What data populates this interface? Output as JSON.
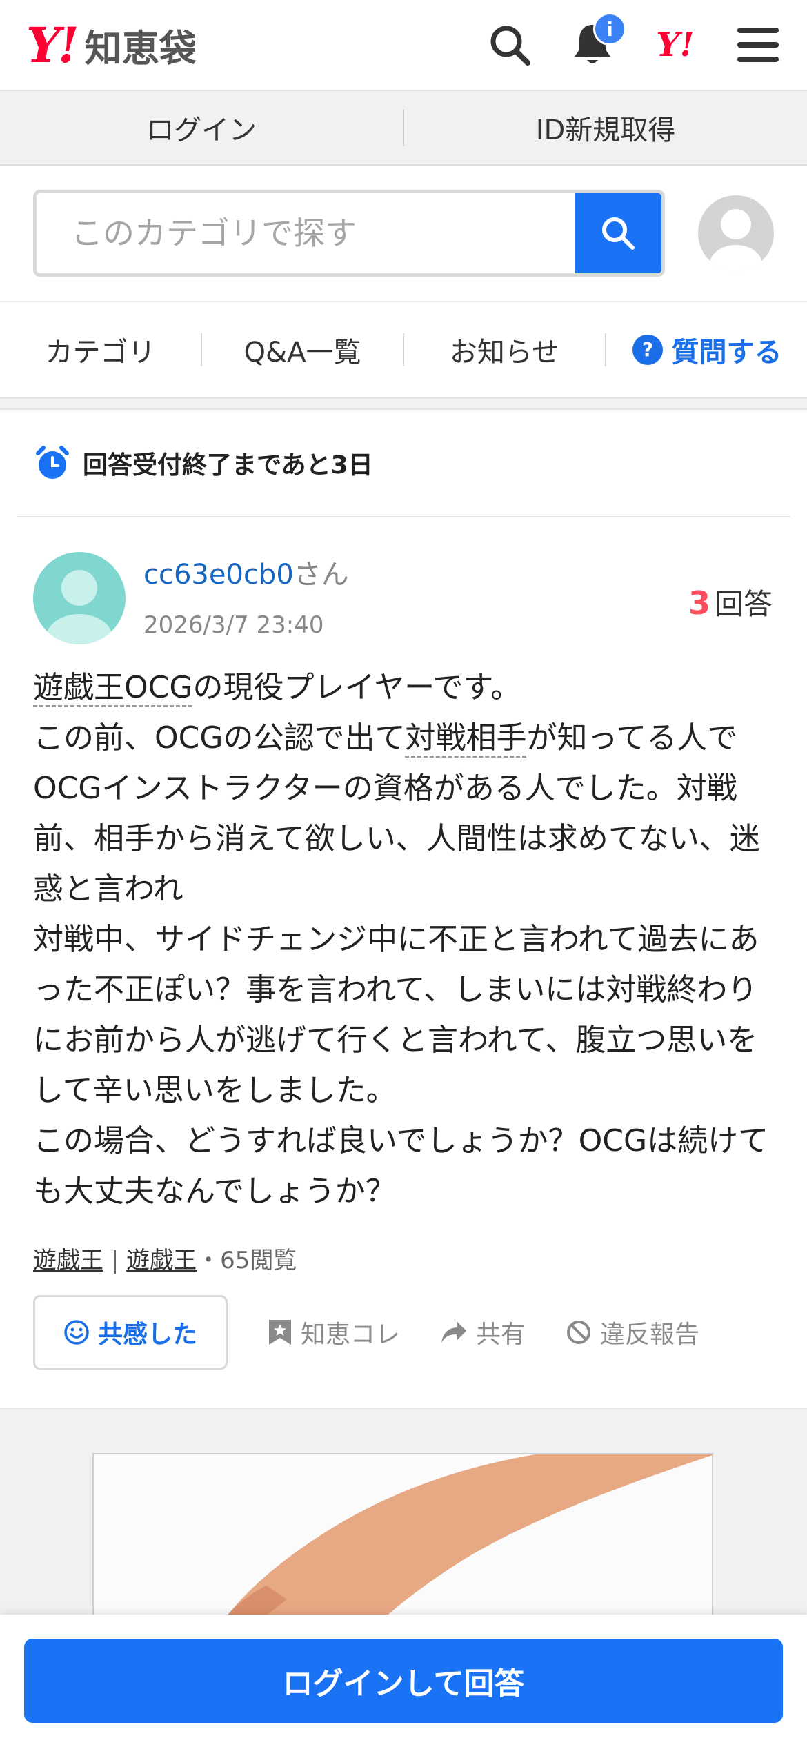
{
  "header": {
    "logo_mark": "Y!",
    "brand": "知恵袋",
    "notification_badge": "i",
    "yahoo_mark": "Y!"
  },
  "login_bar": {
    "login": "ログイン",
    "register": "ID新規取得"
  },
  "search": {
    "placeholder": "このカテゴリで探す"
  },
  "tabs": {
    "category": "カテゴリ",
    "qa_list": "Q&A一覧",
    "news": "お知らせ",
    "ask": "質問する"
  },
  "deadline": {
    "text": "回答受付終了まであと3日"
  },
  "question": {
    "user": "cc63e0cb0",
    "user_suffix": "さん",
    "date": "2026/3/7 23:40",
    "answer_count": "3",
    "answer_label": "回答",
    "body": {
      "kw1": "遊戯王OCG",
      "p1": "の現役プレイヤーです。\nこの前、OCGの公認で出て",
      "kw2": "対戦相手",
      "p2": "が知ってる人でOCGインストラクターの資格がある人でした。対戦前、相手から消えて欲しい、人間性は求めてない、迷惑と言われ\n対戦中、サイドチェンジ中に不正と言われて過去にあった不正ぽい？事を言われて、しまいには対戦終わりにお前から人が逃げて行くと言われて、腹立つ思いをして辛い思いをしました。\nこの場合、どうすれば良いでしょうか？OCGは続けても大丈夫なんでしょうか？"
    },
    "category1": "遊戯王",
    "category_sep": "|",
    "category2": "遊戯王",
    "views": "・65閲覧"
  },
  "actions": {
    "empathy": "共感した",
    "chiecolle": "知恵コレ",
    "share": "共有",
    "report": "違反報告"
  },
  "bottom": {
    "answer_button": "ログインして回答"
  },
  "colors": {
    "accent_blue": "#1a73f5",
    "yahoo_red": "#ff0033",
    "answer_count_red": "#ff4d5e"
  }
}
